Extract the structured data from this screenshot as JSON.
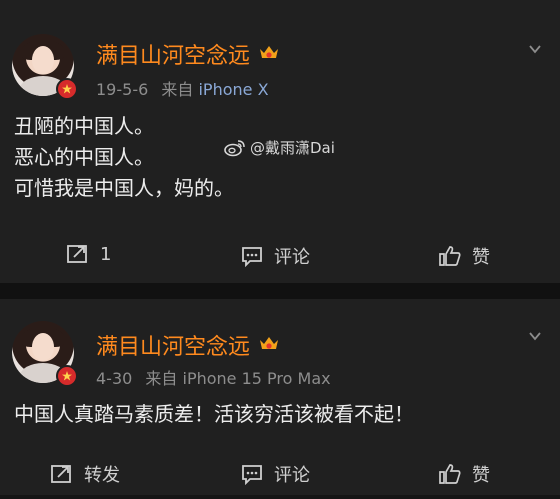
{
  "watermark": {
    "text": "@戴雨潇Dai"
  },
  "posts": [
    {
      "username": "满目山河空念远",
      "date": "19-5-6",
      "source": "来自",
      "device": "iPhone X",
      "lines": [
        "丑陋的中国人。",
        "恶心的中国人。",
        "可惜我是中国人，妈的。"
      ],
      "actions": {
        "repost": "1",
        "comment": "评论",
        "like": "赞"
      }
    },
    {
      "username": "满目山河空念远",
      "date": "4-30",
      "source": "来自",
      "device": "iPhone 15 Pro Max",
      "lines": [
        "中国人真踏马素质差！活该穷活该被看不起！"
      ],
      "actions": {
        "repost": "转发",
        "comment": "评论",
        "like": "赞"
      }
    }
  ],
  "colors": {
    "username": "#ff8a1e",
    "device": "#8aa8d6",
    "meta": "#8d8d8d"
  }
}
